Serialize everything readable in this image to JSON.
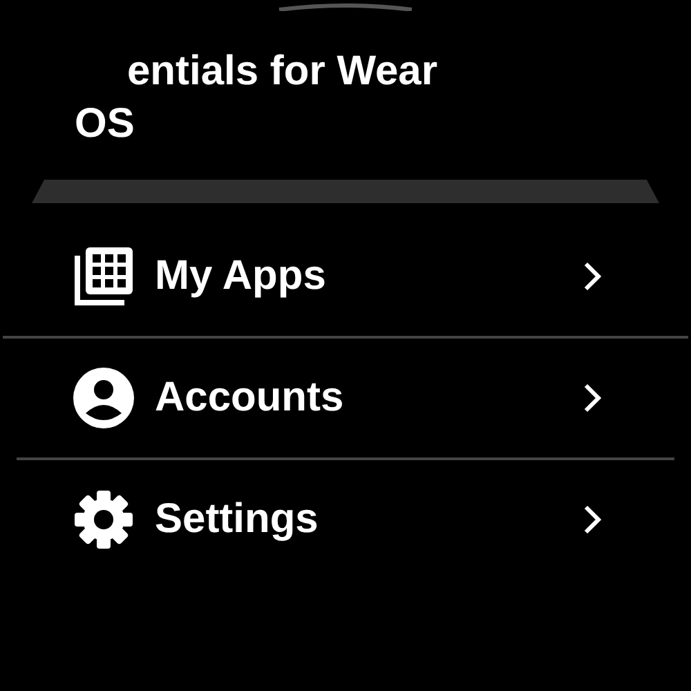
{
  "header": {
    "title_lines": [
      "entials for Wear",
      "OS"
    ]
  },
  "menu": [
    {
      "label": "My Apps"
    },
    {
      "label": "Accounts"
    },
    {
      "label": "Settings"
    }
  ]
}
